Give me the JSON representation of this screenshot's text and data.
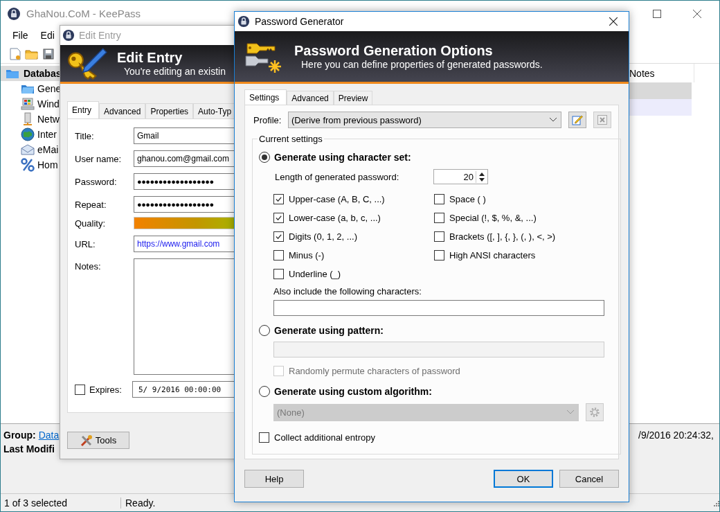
{
  "main_window": {
    "title": "GhaNou.CoM - KeePass",
    "menu": [
      "File",
      "Edi"
    ],
    "tree": [
      {
        "label": "Databas",
        "selected": true,
        "children": [
          {
            "label": "Gene",
            "selected": false
          },
          {
            "label": "Wind",
            "selected": false
          },
          {
            "label": "Netw",
            "selected": false
          },
          {
            "label": "Inter",
            "selected": false
          },
          {
            "label": "eMai",
            "selected": false
          },
          {
            "label": "Hom",
            "selected": false
          }
        ]
      }
    ],
    "list": {
      "columns": [
        "Notes"
      ],
      "rows": [
        {
          "selected": true
        },
        {
          "selected": false
        }
      ]
    },
    "details": {
      "group_label": "Group:",
      "group_link": "Data",
      "modified_label": "Last Modifi",
      "modified_value": "/9/2016 20:24:32,"
    },
    "status_bar": [
      "1 of 3 selected",
      "Ready."
    ]
  },
  "edit_entry": {
    "title": "Edit Entry",
    "banner_title": "Edit Entry",
    "banner_subtitle": "You're editing an existin",
    "tabs": [
      {
        "label": "Entry",
        "selected": true
      },
      {
        "label": "Advanced",
        "selected": false
      },
      {
        "label": "Properties",
        "selected": false
      },
      {
        "label": "Auto-Typ",
        "selected": false
      }
    ],
    "fields": [
      {
        "label": "Title:",
        "kind": "text",
        "value": "Gmail"
      },
      {
        "label": "User name:",
        "kind": "text",
        "value": "ghanou.com@gmail.com"
      },
      {
        "label": "Password:",
        "kind": "password",
        "value": "●●●●●●●●●●●●●●●●●●"
      },
      {
        "label": "Repeat:",
        "kind": "password",
        "value": "●●●●●●●●●●●●●●●●●●"
      },
      {
        "label": "Quality:",
        "kind": "meter"
      },
      {
        "label": "URL:",
        "kind": "url",
        "value": "https://www.gmail.com"
      },
      {
        "label": "Notes:",
        "kind": "notes"
      }
    ],
    "expires": {
      "label": "Expires:",
      "checked": false,
      "value": "5/  9/2016 00:00:00"
    },
    "tools_button": "Tools"
  },
  "generator": {
    "title": "Password Generator",
    "banner_title": "Password Generation Options",
    "banner_subtitle": "Here you can define properties of generated passwords.",
    "tabs": [
      {
        "label": "Settings",
        "selected": true
      },
      {
        "label": "Advanced",
        "selected": false
      },
      {
        "label": "Preview",
        "selected": false
      }
    ],
    "profile": {
      "label": "Profile:",
      "value": "(Derive from previous password)"
    },
    "group_title": "Current settings",
    "charset_mode": {
      "label": "Generate using character set:",
      "selected": true
    },
    "length": {
      "label": "Length of generated password:",
      "value": "20"
    },
    "options_left": [
      {
        "label": "Upper-case (A, B, C, ...)",
        "checked": true
      },
      {
        "label": "Lower-case (a, b, c, ...)",
        "checked": true
      },
      {
        "label": "Digits (0, 1, 2, ...)",
        "checked": true
      },
      {
        "label": "Minus (-)",
        "checked": false
      },
      {
        "label": "Underline (_)",
        "checked": false
      }
    ],
    "options_right": [
      {
        "label": "Space ( )",
        "checked": false
      },
      {
        "label": "Special (!, $, %, &, ...)",
        "checked": false
      },
      {
        "label": "Brackets ([, ], {, }, (, ), <, >)",
        "checked": false
      },
      {
        "label": "High ANSI characters",
        "checked": false
      }
    ],
    "also_include": {
      "label": "Also include the following characters:"
    },
    "pattern_mode": {
      "label": "Generate using pattern:",
      "selected": false
    },
    "pattern_field": {
      "disabled": true
    },
    "permute": {
      "label": "Randomly permute characters of password",
      "checked": false,
      "disabled": true
    },
    "algorithm_mode": {
      "label": "Generate using custom algorithm:",
      "selected": false
    },
    "algorithm": {
      "value": "(None)",
      "disabled": true
    },
    "entropy": {
      "label": "Collect additional entropy",
      "checked": false
    },
    "buttons": [
      {
        "label": "Help",
        "default": false
      },
      {
        "label": "OK",
        "default": true
      },
      {
        "label": "Cancel",
        "default": false
      }
    ]
  }
}
